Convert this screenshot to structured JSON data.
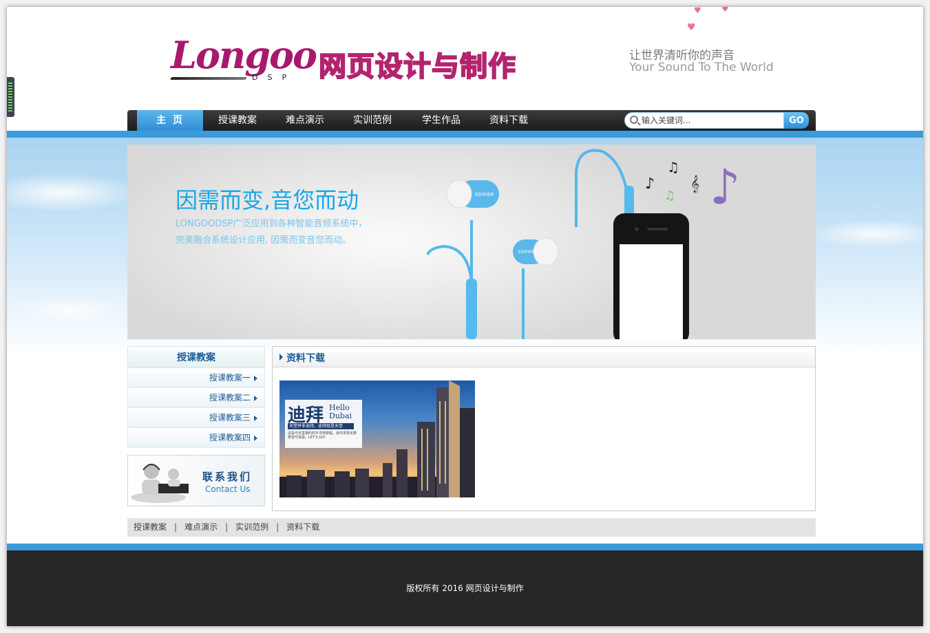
{
  "header": {
    "logo_text": "Longoo",
    "logo_sub": "DSP",
    "site_title": "网页设计与制作",
    "slogan_cn": "让世界清听你的声音",
    "slogan_en": "Your Sound To The World"
  },
  "nav": {
    "items": [
      {
        "label": "主页"
      },
      {
        "label": "授课教案"
      },
      {
        "label": "难点演示"
      },
      {
        "label": "实训范例"
      },
      {
        "label": "学生作品"
      },
      {
        "label": "资料下载"
      }
    ],
    "search_placeholder": "输入关键词...",
    "go_label": "GO"
  },
  "banner": {
    "title": "因需而变,音您而动",
    "line1": "LONGOODSP广泛应用到各种智能音频系统中，",
    "line2": "完美融合系统设计应用, 因需而变音您而动。",
    "product_brand": "EDIFIER"
  },
  "sidebar": {
    "title": "授课教案",
    "items": [
      {
        "label": "授课教案一"
      },
      {
        "label": "授课教案二"
      },
      {
        "label": "授课教案三"
      },
      {
        "label": "授课教案四"
      }
    ],
    "contact_cn": "联系我们",
    "contact_en": "Contact Us"
  },
  "panel": {
    "title": "资料下载",
    "image_big": "迪拜",
    "image_hello": "Hello",
    "image_city": "Dubai",
    "image_tag": "天堂并非迪拜，迪拜就是天堂",
    "image_small": "这是与天堂相约的不寻常旅程，途中发现无数奇迹与惊喜。LET'S GO!"
  },
  "footer_links": [
    {
      "label": "授课教案"
    },
    {
      "label": "难点演示"
    },
    {
      "label": "实训范例"
    },
    {
      "label": "资料下载"
    }
  ],
  "footer": {
    "copyright": "版权所有 2016 网页设计与制作"
  },
  "colors": {
    "accent_blue": "#3b9ad9",
    "logo_magenta": "#a8196e",
    "banner_title": "#19a6e6",
    "footer_bg": "#262626"
  }
}
